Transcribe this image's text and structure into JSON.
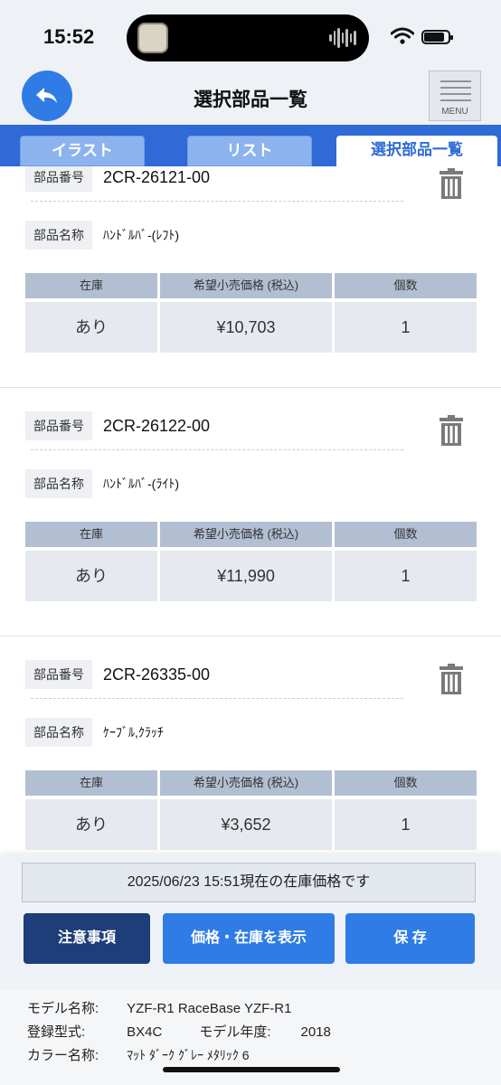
{
  "status": {
    "time": "15:52"
  },
  "header": {
    "title": "選択部品一覧",
    "menu_label": "MENU"
  },
  "tabs": [
    "イラスト",
    "リスト",
    "選択部品一覧"
  ],
  "labels": {
    "part_number": "部品番号",
    "part_name": "部品名称",
    "col_stock": "在庫",
    "col_price": "希望小売価格 (税込)",
    "col_qty": "個数"
  },
  "parts": [
    {
      "number": "2CR-26121-00",
      "name": "ﾊﾝﾄﾞﾙﾊﾞ-(ﾚﾌﾄ)",
      "stock": "あり",
      "price": "¥10,703",
      "qty": "1"
    },
    {
      "number": "2CR-26122-00",
      "name": "ﾊﾝﾄﾞﾙﾊﾞ-(ﾗｲﾄ)",
      "stock": "あり",
      "price": "¥11,990",
      "qty": "1"
    },
    {
      "number": "2CR-26335-00",
      "name": "ｹｰﾌﾞﾙ,ｸﾗｯﾁ",
      "stock": "あり",
      "price": "¥3,652",
      "qty": "1"
    }
  ],
  "footer": {
    "stock_note": "2025/06/23 15:51現在の在庫価格です",
    "btn_notes": "注意事項",
    "btn_show": "価格・在庫を表示",
    "btn_save": "保 存",
    "model_name_label": "モデル名称:",
    "model_name": "YZF-R1 RaceBase YZF-R1",
    "reg_type_label": "登録型式:",
    "reg_type": "BX4C",
    "model_year_label": "モデル年度:",
    "model_year": "2018",
    "color_label": "カラー名称:",
    "color": "ﾏｯﾄ ﾀﾞｰｸ ｸﾞﾚｰ ﾒﾀﾘｯｸ 6"
  },
  "colors": {
    "accent": "#2f7ce6",
    "tabbar": "#2f6ad6",
    "dark_button": "#1d3e78"
  }
}
